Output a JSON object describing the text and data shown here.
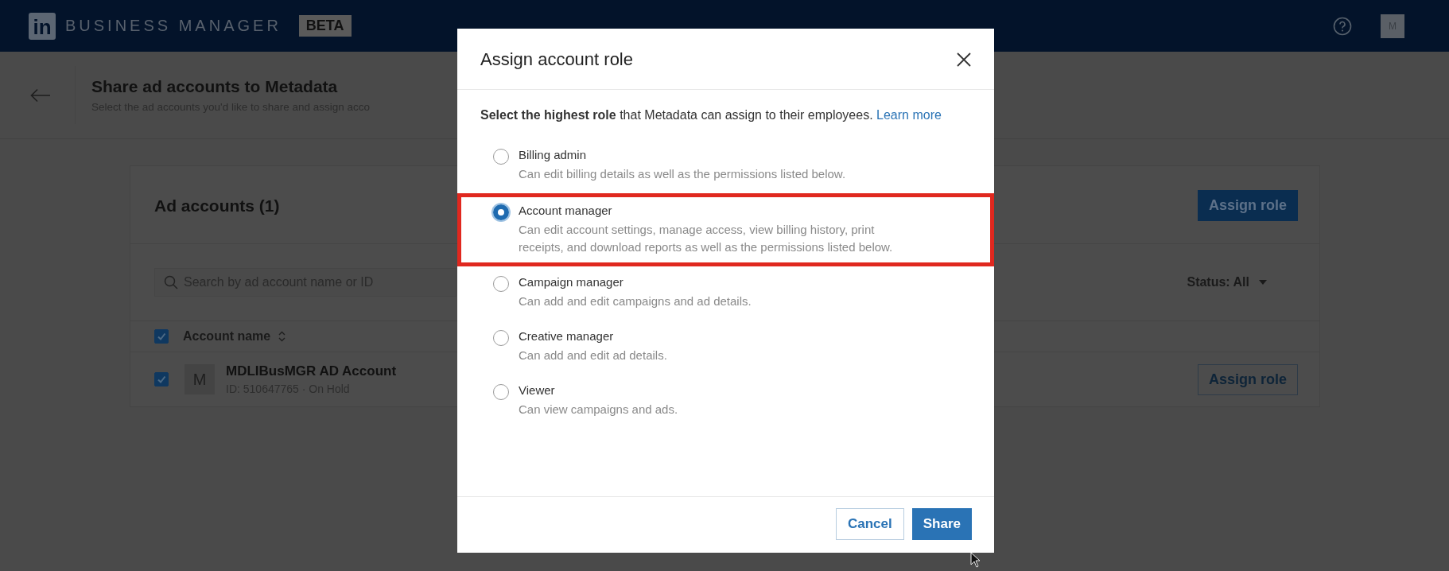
{
  "header": {
    "logo": "in",
    "brand": "BUSINESS MANAGER",
    "badge": "BETA",
    "avatar": "M"
  },
  "page_header": {
    "title": "Share ad accounts to Metadata",
    "subtitle": "Select the ad accounts you'd like to share and assign acco"
  },
  "card": {
    "title": "Ad accounts (1)",
    "assign_button": "Assign role",
    "search": {
      "placeholder": "Search by ad account name or ID"
    },
    "status_filter": "Status: All",
    "columns": [
      {
        "label": "Account name",
        "checked": true
      }
    ],
    "rows": [
      {
        "avatar": "M",
        "name": "MDLIBusMGR AD Account",
        "meta": "ID: 510647765 · On Hold",
        "checked": true,
        "action": "Assign role"
      }
    ]
  },
  "modal": {
    "title": "Assign account role",
    "intro": "**Select the highest role** that Metadata can assign to their employees.",
    "link": "Learn more",
    "options": [
      {
        "label": "Billing admin",
        "description": "Can edit billing details as well as the permissions listed below.",
        "selected": false,
        "highlighted": false
      },
      {
        "label": "Account manager",
        "description": "Can edit account settings, manage access, view billing history, print receipts, and download reports as well as the permissions listed below.",
        "selected": true,
        "highlighted": true
      },
      {
        "label": "Campaign manager",
        "description": "Can add and edit campaigns and ad details.",
        "selected": false,
        "highlighted": false
      },
      {
        "label": "Creative manager",
        "description": "Can add and edit ad details.",
        "selected": false,
        "highlighted": false
      },
      {
        "label": "Viewer",
        "description": "Can view campaigns and ads.",
        "selected": false,
        "highlighted": false
      }
    ],
    "cancel": "Cancel",
    "confirm": "Share"
  }
}
